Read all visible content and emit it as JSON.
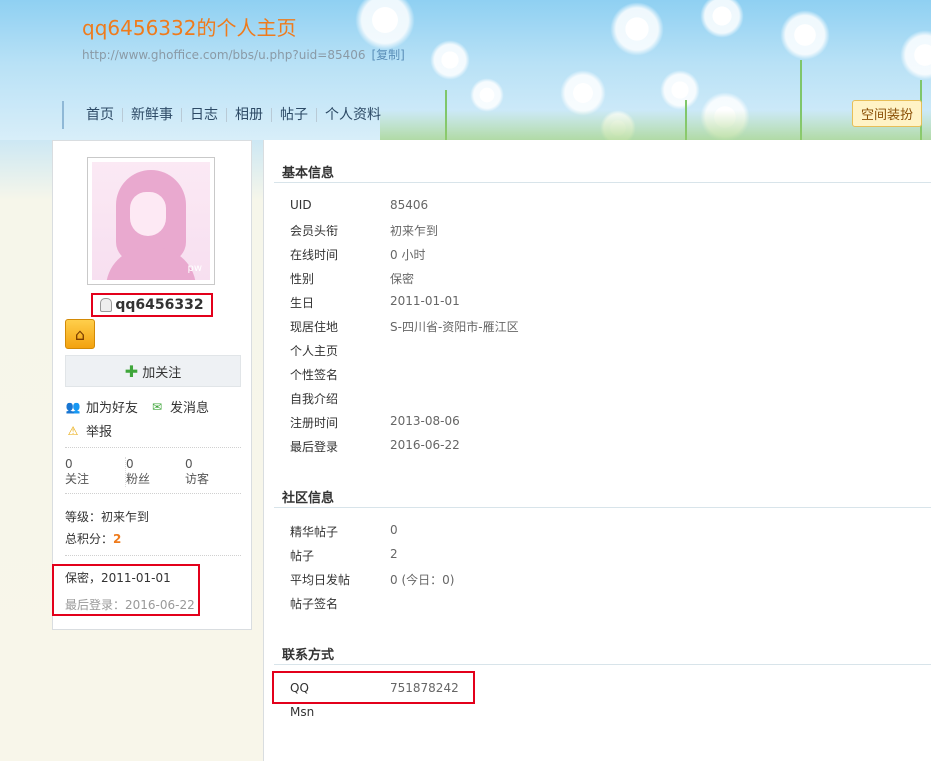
{
  "header": {
    "title": "qq6456332的个人主页",
    "url": "http://www.ghoffice.com/bbs/u.php?uid=85406",
    "copy_label": "[复制]",
    "nav": [
      "首页",
      "新鲜事",
      "日志",
      "相册",
      "帖子",
      "个人资料"
    ],
    "skin_button": "空间装扮"
  },
  "profile": {
    "avatar_mark": "pw",
    "username": "qq6456332",
    "follow_label": "加关注",
    "add_friend": "加为好友",
    "send_message": "发消息",
    "report": "举报",
    "stats": [
      {
        "value": "0",
        "label": "关注"
      },
      {
        "value": "0",
        "label": "粉丝"
      },
      {
        "value": "0",
        "label": "访客"
      }
    ],
    "level_label": "等级：",
    "level_value": "初来乍到",
    "points_label": "总积分：",
    "points_value": "2",
    "birth_line": "保密，2011-01-01",
    "last_login_line": "最后登录：2016-06-22"
  },
  "basic": {
    "title": "基本信息",
    "rows": [
      {
        "k": "UID",
        "v": "85406"
      },
      {
        "k": "会员头衔",
        "v": "初来乍到"
      },
      {
        "k": "在线时间",
        "v": "0 小时"
      },
      {
        "k": "性别",
        "v": "保密"
      },
      {
        "k": "生日",
        "v": "2011-01-01"
      },
      {
        "k": "现居住地",
        "v": "S-四川省-资阳市-雁江区"
      },
      {
        "k": "个人主页",
        "v": ""
      },
      {
        "k": "个性签名",
        "v": ""
      },
      {
        "k": "自我介绍",
        "v": ""
      },
      {
        "k": "注册时间",
        "v": "2013-08-06"
      },
      {
        "k": "最后登录",
        "v": "2016-06-22"
      }
    ]
  },
  "community": {
    "title": "社区信息",
    "rows": [
      {
        "k": "精华帖子",
        "v": "0"
      },
      {
        "k": "帖子",
        "v": "2"
      },
      {
        "k": "平均日发帖",
        "v": "0 (今日：0)"
      },
      {
        "k": "帖子签名",
        "v": ""
      }
    ]
  },
  "contact": {
    "title": "联系方式",
    "rows": [
      {
        "k": "QQ",
        "v": "751878242"
      },
      {
        "k": "Msn",
        "v": ""
      }
    ]
  },
  "colors": {
    "title": "#ef7b1c",
    "highlight_border": "#e3001b"
  }
}
